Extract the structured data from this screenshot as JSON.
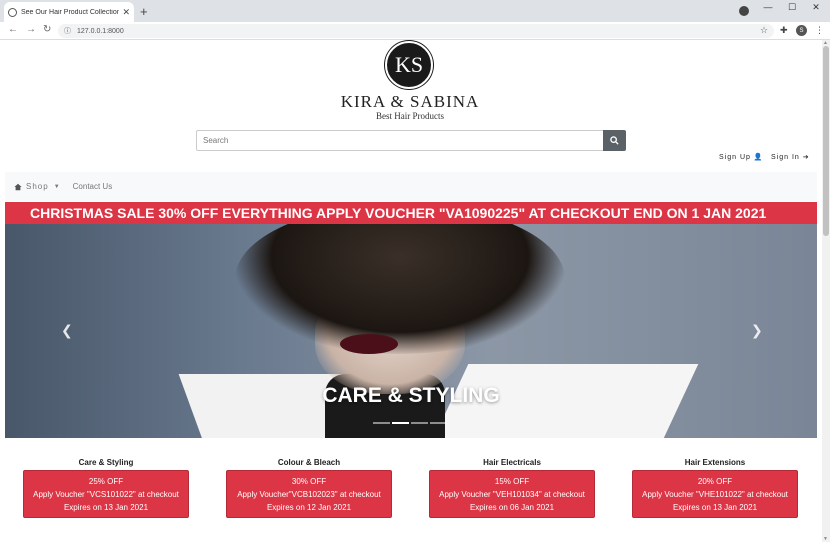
{
  "browser": {
    "tab_title": "See Our Hair Product Collection",
    "tab_close": "✕",
    "new_tab": "+",
    "url": "127.0.0.1:8000",
    "profile_initial": "S"
  },
  "header": {
    "logo_text": "KS",
    "brand": "KIRA & SABINA",
    "tagline": "Best Hair Products",
    "search_placeholder": "Search",
    "sign_up": "Sign Up",
    "sign_in": "Sign In"
  },
  "nav": {
    "shop": "Shop",
    "contact": "Contact Us"
  },
  "banner": {
    "text": "CHRISTMAS SALE 30% OFF EVERYTHING APPLY VOUCHER \"VA1090225\" AT CHECKOUT END ON 1 JAN 2021",
    "color": "#dc3545"
  },
  "carousel": {
    "caption": "CARE & STYLING",
    "prev_icon": "chevron-left-icon",
    "next_icon": "chevron-right-icon",
    "slide_count": 4,
    "active_slide": 2
  },
  "promos": [
    {
      "title": "Care & Styling",
      "discount": "25% OFF",
      "voucher": "Apply Voucher \"VCS101022\" at checkout",
      "expires": "Expires on 13 Jan 2021"
    },
    {
      "title": "Colour & Bleach",
      "discount": "30% OFF",
      "voucher": "Apply Voucher\"VCB102023\" at checkout",
      "expires": "Expires on 12 Jan 2021"
    },
    {
      "title": "Hair Electricals",
      "discount": "15% OFF",
      "voucher": "Apply Voucher \"VEH101034\" at checkout",
      "expires": "Expires on 06 Jan 2021"
    },
    {
      "title": "Hair Extensions",
      "discount": "20% OFF",
      "voucher": "Apply Voucher \"VHE101022\" at checkout",
      "expires": "Expires on 13 Jan 2021"
    }
  ]
}
